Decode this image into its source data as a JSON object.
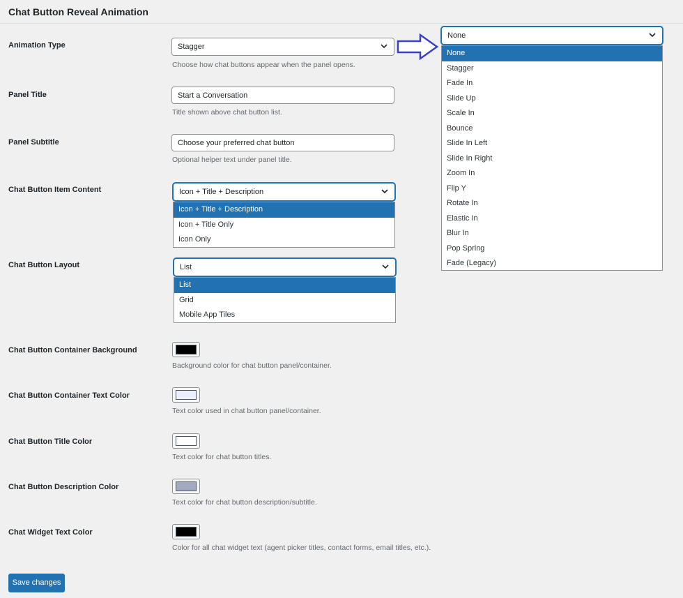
{
  "section_title": "Chat Button Reveal Animation",
  "animation_type": {
    "label": "Animation Type",
    "value": "Stagger",
    "description": "Choose how chat buttons appear when the panel opens.",
    "dropdown_value": "None",
    "options": [
      "None",
      "Stagger",
      "Fade In",
      "Slide Up",
      "Scale In",
      "Bounce",
      "Slide In Left",
      "Slide In Right",
      "Zoom In",
      "Flip Y",
      "Rotate In",
      "Elastic In",
      "Blur In",
      "Pop Spring",
      "Fade (Legacy)"
    ],
    "selected_option": "None"
  },
  "panel_title": {
    "label": "Panel Title",
    "value": "Start a Conversation",
    "description": "Title shown above chat button list."
  },
  "panel_subtitle": {
    "label": "Panel Subtitle",
    "value": "Choose your preferred chat button",
    "description": "Optional helper text under panel title."
  },
  "item_content": {
    "label": "Chat Button Item Content",
    "value": "Icon + Title + Description",
    "options": [
      "Icon + Title + Description",
      "Icon + Title Only",
      "Icon Only"
    ],
    "selected_option": "Icon + Title + Description"
  },
  "layout": {
    "label": "Chat Button Layout",
    "value": "List",
    "options": [
      "List",
      "Grid",
      "Mobile App Tiles"
    ],
    "selected_option": "List"
  },
  "colors": [
    {
      "label": "Chat Button Container Background",
      "color": "#000000",
      "description": "Background color for chat button panel/container."
    },
    {
      "label": "Chat Button Container Text Color",
      "color": "#eaf0ff",
      "description": "Text color used in chat button panel/container."
    },
    {
      "label": "Chat Button Title Color",
      "color": "#ffffff",
      "description": "Text color for chat button titles."
    },
    {
      "label": "Chat Button Description Color",
      "color": "#a3abc2",
      "description": "Text color for chat button description/subtitle."
    },
    {
      "label": "Chat Widget Text Color",
      "color": "#000000",
      "description": "Color for all chat widget text (agent picker titles, contact forms, email titles, etc.)."
    }
  ],
  "save_button": "Save changes",
  "accent_color": "#2271b1",
  "arrow_color": "#3b3ec7"
}
